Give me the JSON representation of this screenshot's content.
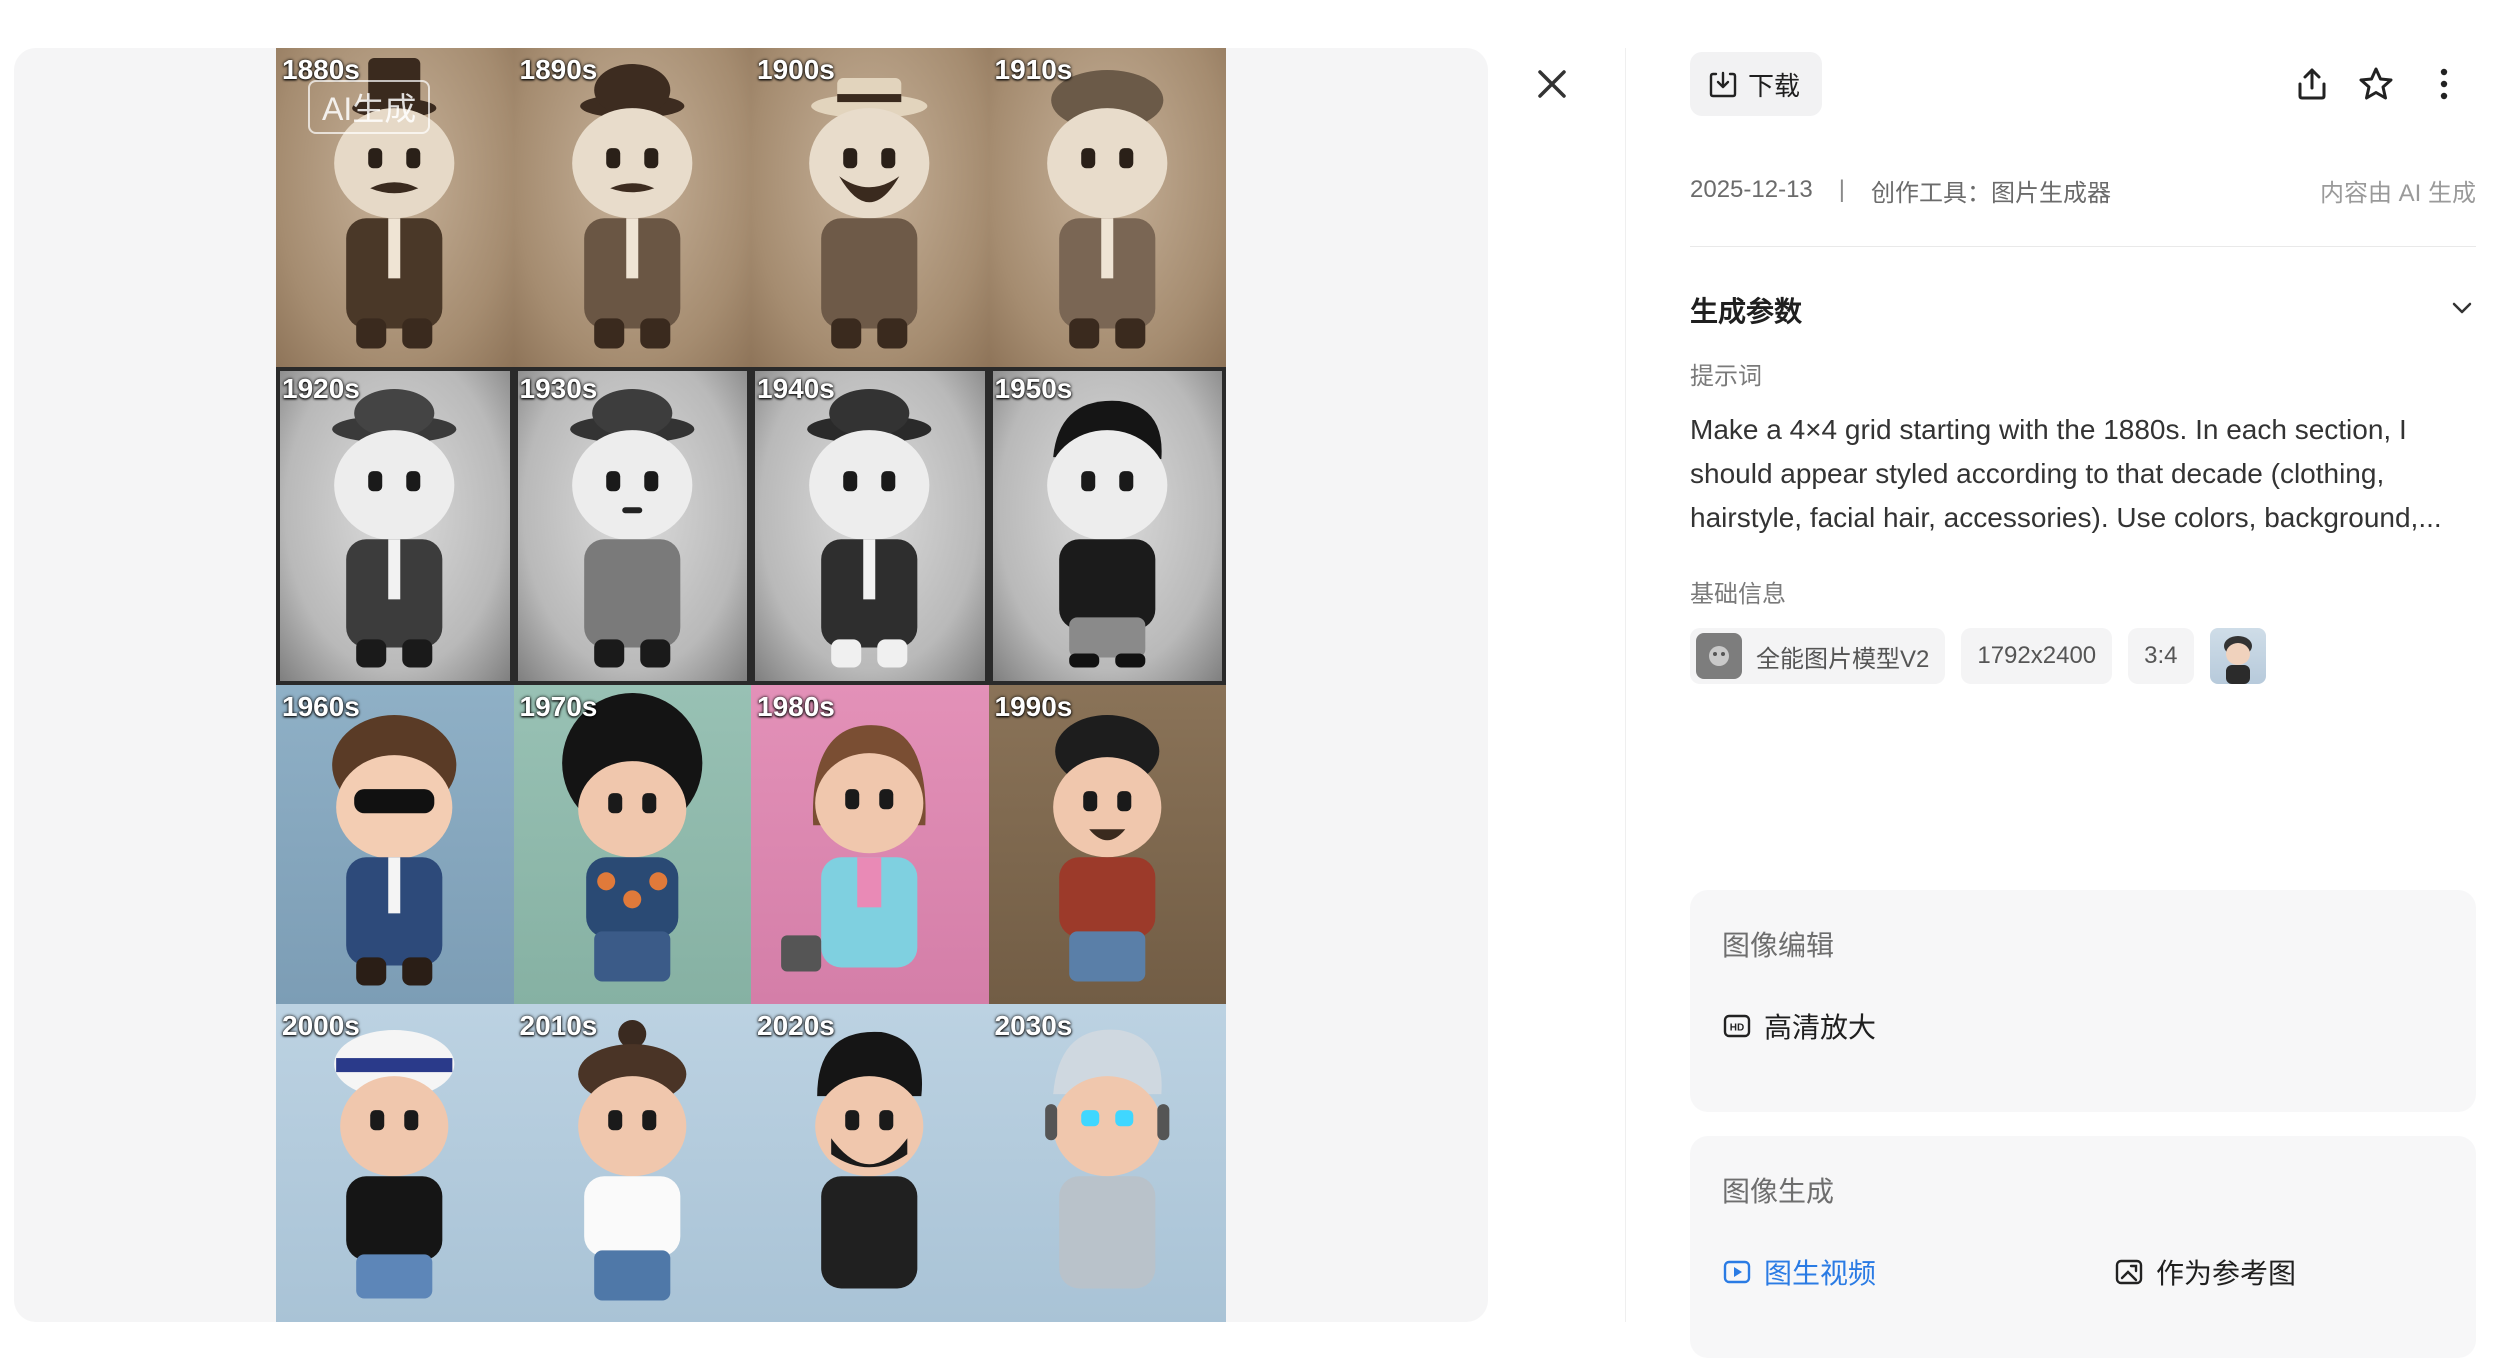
{
  "viewer": {
    "watermark": "AI生成",
    "decades": [
      "1880s",
      "1890s",
      "1900s",
      "1910s",
      "1920s",
      "1930s",
      "1940s",
      "1950s",
      "1960s",
      "1970s",
      "1980s",
      "1990s",
      "2000s",
      "2010s",
      "2020s",
      "2030s"
    ],
    "close_icon": "close-icon"
  },
  "toolbar": {
    "download_label": "下载",
    "icons": [
      "download-icon",
      "share-icon",
      "star-icon",
      "more-icon"
    ]
  },
  "meta": {
    "date": "2025-12-13",
    "separator": "|",
    "tool": "创作工具：图片生成器",
    "ai_notice": "内容由 AI 生成"
  },
  "params": {
    "title": "生成参数",
    "prompt_label": "提示词",
    "prompt_text": "Make a 4×4 grid starting with the 1880s. In each section, I should appear styled according to that decade (clothing, hairstyle, facial hair, accessories). Use colors, background,...",
    "basic_info_label": "基础信息",
    "model": "全能图片模型V2",
    "resolution": "1792x2400",
    "ratio": "3:4"
  },
  "edit_card": {
    "title": "图像编辑",
    "upscale_label": "高清放大"
  },
  "gen_card": {
    "title": "图像生成",
    "to_video_label": "图生视频",
    "as_reference_label": "作为参考图"
  },
  "colors": {
    "accent_blue": "#2a7be4",
    "text_primary": "#1f1f1f",
    "text_secondary": "#7a7a7a",
    "panel_bg": "#f7f7f8"
  }
}
